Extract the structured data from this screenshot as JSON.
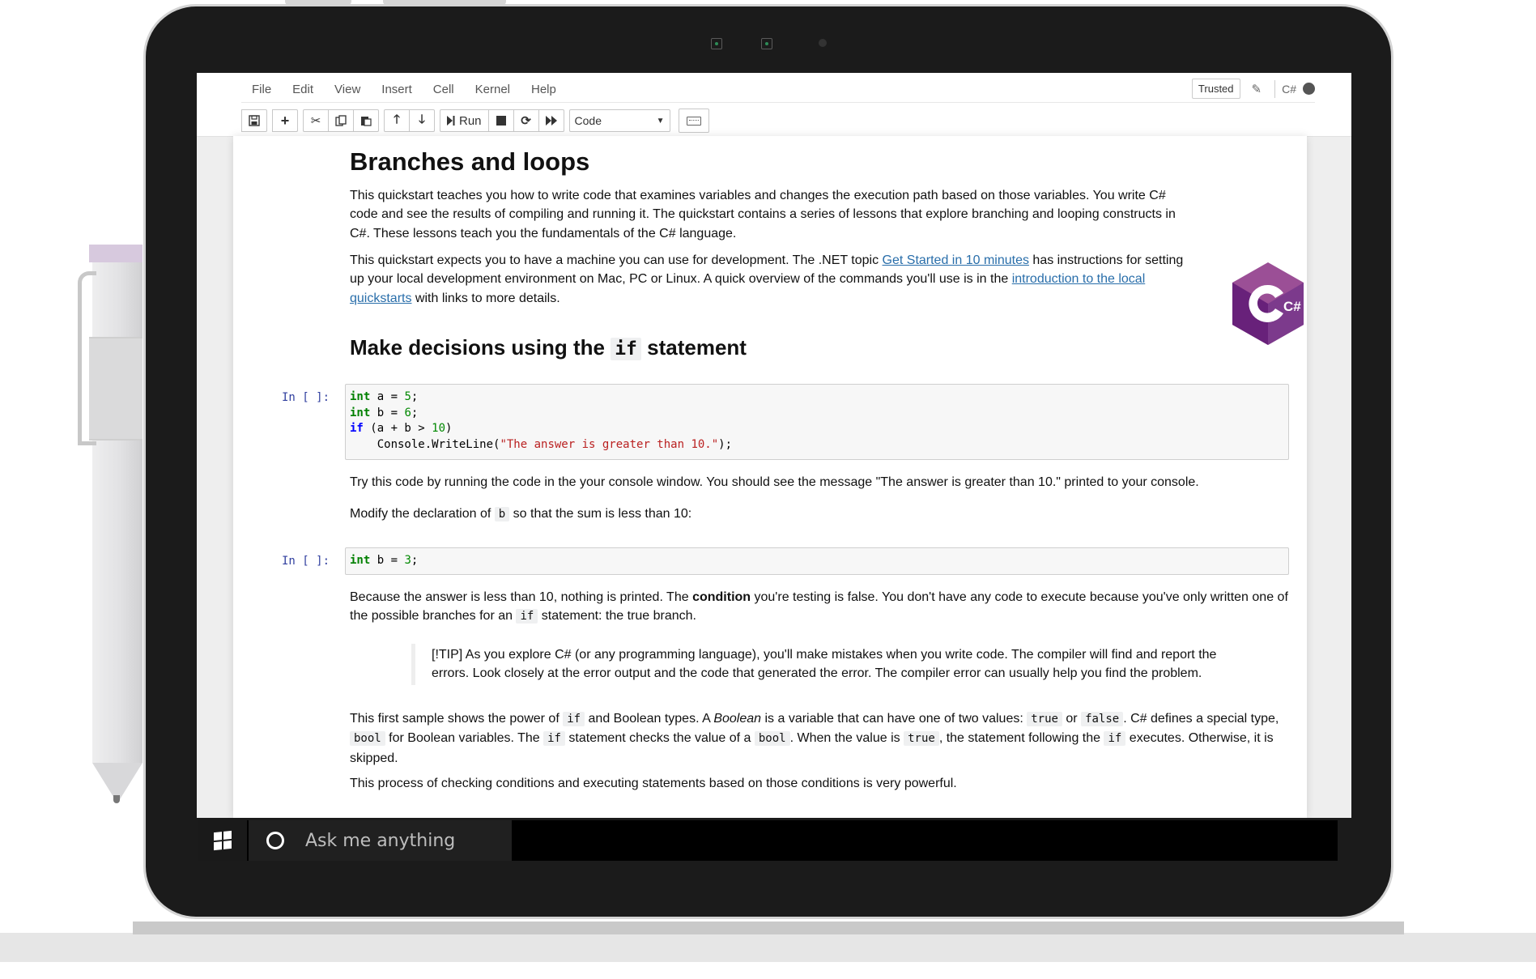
{
  "menu": {
    "items": [
      "File",
      "Edit",
      "View",
      "Insert",
      "Cell",
      "Kernel",
      "Help"
    ],
    "trusted": "Trusted",
    "kernel": "C#"
  },
  "toolbar": {
    "run_label": "Run",
    "cell_type": "Code"
  },
  "notebook": {
    "title": "Branches and loops",
    "intro_p1": "This quickstart teaches you how to write code that examines variables and changes the execution path based on those variables. You write C# code and see the results of compiling and running it. The quickstart contains a series of lessons that explore branching and looping constructs in C#. These lessons teach you the fundamentals of the C# language.",
    "intro_p2_a": "This quickstart expects you to have a machine you can use for development. The .NET topic ",
    "intro_p2_link1": "Get Started in 10 minutes",
    "intro_p2_b": " has instructions for setting up your local development environment on Mac, PC or Linux. A quick overview of the commands you'll use is in the ",
    "intro_p2_link2": "introduction to the local quickstarts",
    "intro_p2_c": " with links to more details.",
    "h2_a": "Make decisions using the ",
    "h2_code": "if",
    "h2_b": " statement",
    "prompt": "In [ ]:",
    "cell1": [
      "int",
      " a = ",
      "5",
      ";",
      "int",
      " b = ",
      "6",
      ";",
      "if",
      " (a + b > ",
      "10",
      ")",
      "    Console.WriteLine(",
      "\"The answer is greater than 10.\"",
      ");"
    ],
    "try_p": "Try this code by running the code in the your console window. You should see the message \"The answer is greater than 10.\" printed to your console.",
    "modify_a": "Modify the declaration of ",
    "modify_code": "b",
    "modify_b": " so that the sum is less than 10:",
    "cell2": [
      "int",
      " b = ",
      "3",
      ";"
    ],
    "because_a": "Because the answer is less than 10, nothing is printed. The ",
    "because_bold": "condition",
    "because_b": " you're testing is false. You don't have any code to execute because you've only written one of the possible branches for an ",
    "because_code": "if",
    "because_c": " statement: the true branch.",
    "tip": "[!TIP] As you explore C# (or any programming language), you'll make mistakes when you write code. The compiler will find and report the errors. Look closely at the error output and the code that generated the error. The compiler error can usually help you find the problem.",
    "sample": [
      "This first sample shows the power of ",
      "if",
      " and Boolean types. A ",
      "Boolean",
      " is a variable that can have one of two values: ",
      "true",
      " or ",
      "false",
      ". C# defines a special type, ",
      "bool",
      " for Boolean variables. The ",
      "if",
      " statement checks the value of a ",
      "bool",
      ". When the value is ",
      "true",
      ", the statement following the ",
      "if",
      " executes. Otherwise, it is skipped."
    ],
    "process_p": "This process of checking conditions and executing statements based on those conditions is very powerful.",
    "logo_text": "C#"
  },
  "taskbar": {
    "search_placeholder": "Ask me anything"
  },
  "colors": {
    "link": "#296eaa",
    "prompt": "#303f9f",
    "logo_purple": "#68217a"
  }
}
